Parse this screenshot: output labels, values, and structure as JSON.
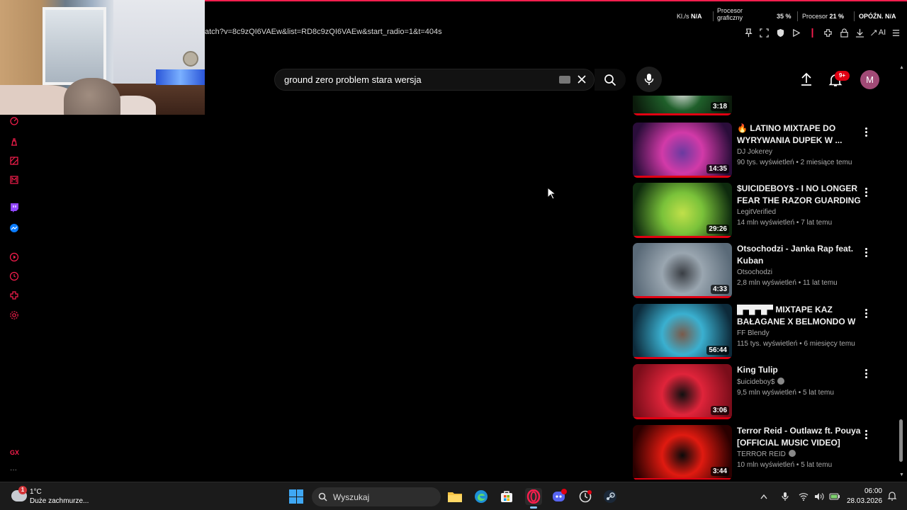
{
  "browser": {
    "url": "atch?v=8c9zQI6VAEw&list=RD8c9zQI6VAEw&start_radio=1&t=404s",
    "ai_label": "AI",
    "stats": {
      "net_label": "Kl./s",
      "net_value": "N/A",
      "gpu_label_1": "Procesor",
      "gpu_label_2": "graficzny",
      "gpu_value": "35 %",
      "cpu_label": "Procesor",
      "cpu_value": "21 %",
      "lag_label": "OPÓŹN.",
      "lag_value": "N/A"
    }
  },
  "youtube": {
    "search_query": "ground zero problem stara wersja",
    "notifications_badge": "9+",
    "avatar_initial": "M",
    "videos": [
      {
        "title": "",
        "channel": "",
        "views": "",
        "age": "",
        "duration": "3:18",
        "thumb_colors": [
          "#0b1a0b",
          "#1f5f2a",
          "#e9e9e9"
        ]
      },
      {
        "title": "🔥 LATINO MIXTAPE DO WYRYWANIA DUPEK W ...",
        "channel": "DJ Jokerey",
        "views": "90 tys. wyświetleń",
        "age": "2 miesiące temu",
        "duration": "14:35",
        "thumb_colors": [
          "#2a0d3a",
          "#d23aa8",
          "#6a3aa0"
        ]
      },
      {
        "title": "$UICIDEBOY$ - I NO LONGER FEAR THE RAZOR GUARDING ...",
        "channel": "LegitVerified",
        "views": "14 mln wyświetleń",
        "age": "7 lat temu",
        "duration": "29:26",
        "thumb_colors": [
          "#0e2a0e",
          "#7ac23a",
          "#c0e04a"
        ]
      },
      {
        "title": "Otsochodzi - Janka Rap feat. Kuban",
        "channel": "Otsochodzi",
        "views": "2,8 mln wyświetleń",
        "age": "11 lat temu",
        "duration": "4:33",
        "thumb_colors": [
          "#5a6a78",
          "#9aa6b0",
          "#3a3e44"
        ]
      },
      {
        "title": "█▀█▀█▀ MIXTAPE KAZ BAŁAGANE X BELMONDO W ...",
        "channel": "FF Blendy",
        "views": "115 tys. wyświetleń",
        "age": "6 miesięcy temu",
        "duration": "56:44",
        "thumb_colors": [
          "#0d2a3a",
          "#3ab0d0",
          "#7a5a4a"
        ]
      },
      {
        "title": "King Tulip",
        "channel": "$uicideboy$",
        "verified": true,
        "views": "9,5 mln wyświetleń",
        "age": "5 lat temu",
        "duration": "3:06",
        "thumb_colors": [
          "#7a0d1a",
          "#e0243a",
          "#101010"
        ]
      },
      {
        "title": "Terror Reid - Outlawz ft. Pouya [OFFICIAL MUSIC VIDEO]",
        "channel": "TERROR REID",
        "verified": true,
        "views": "10 mln wyświetleń",
        "age": "5 lat temu",
        "duration": "3:44",
        "thumb_colors": [
          "#2a0000",
          "#e01a10",
          "#0a0a0a"
        ]
      }
    ]
  },
  "taskbar": {
    "weather_temp": "1°C",
    "weather_desc": "Duże zachmurze...",
    "weather_badge": "1",
    "search_placeholder": "Wyszukaj",
    "time": "06:00",
    "date": "28.03.2026"
  },
  "colors": {
    "accent": "#fa1e4e",
    "youtube_red": "#e00012",
    "taskbar": "#1b1b1b",
    "windows_blue": "#3fa8f4"
  }
}
